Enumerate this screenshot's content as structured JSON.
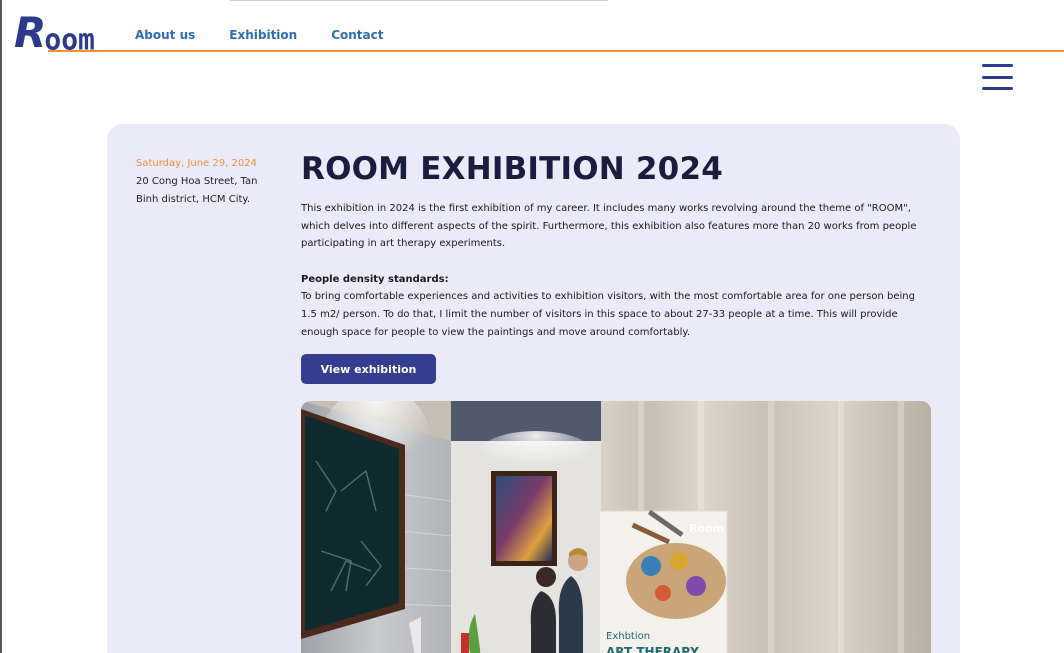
{
  "header": {
    "logo_initial": "R",
    "logo_rest": "oom",
    "nav": [
      {
        "label": "About us"
      },
      {
        "label": "Exhibition"
      },
      {
        "label": "Contact"
      }
    ]
  },
  "event": {
    "date": "Saturday, June 29, 2024",
    "address": "20 Cong Hoa Street, Tan Binh district, HCM City."
  },
  "main": {
    "title": "ROOM EXHIBITION 2024",
    "intro": "This exhibition in 2024 is the first exhibition of my career. It includes many works revolving around the theme of \"ROOM\", which delves into different aspects of the spirit. Furthermore, this exhibition also features more than 20 works from people participating in art therapy experiments.",
    "density_heading": "People density standards:",
    "density_text": "To bring comfortable experiences and activities to exhibition visitors, with the most comfortable area for one person being 1.5 m2/ person. To do that, I limit the number of visitors in this space to about 27-33 people at a time. This will provide enough space for people to view the paintings and move around comfortably.",
    "button_label": "View exhibition"
  },
  "poster": {
    "brand": "Room",
    "line1": "Exhbtion",
    "line2": "ART THERAPY"
  },
  "colors": {
    "brand": "#2d3a8c",
    "accent": "#f0903a",
    "card_bg": "#ebeaf8",
    "button": "#353d8f"
  }
}
